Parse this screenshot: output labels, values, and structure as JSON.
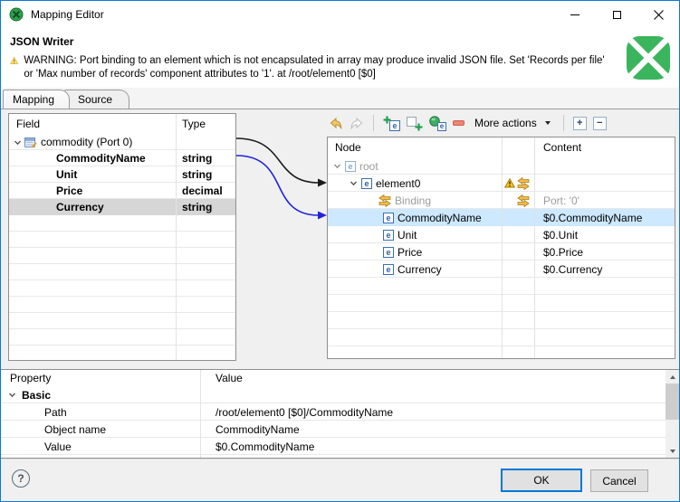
{
  "colors": {
    "window_border": "#0a7ad4",
    "clover_green": "#3bb55d",
    "selection_blue": "#cde8ff",
    "selection_gray": "#d6d6d6",
    "warning_yellow": "#f5bd42",
    "arrow_black": "#1a1a1a",
    "arrow_blue": "#2222dd"
  },
  "window": {
    "title": "Mapping Editor"
  },
  "header": {
    "title": "JSON Writer",
    "warning": "WARNING: Port binding to an element which is not encapsulated in array may produce invalid JSON file. Set 'Records per file' or 'Max number of records' component attributes to '1'. at /root/element0 [$0]"
  },
  "tabs": {
    "mapping": "Mapping",
    "source": "Source"
  },
  "icons": {
    "element_glyph": "e",
    "expand_glyph": "+",
    "collapse_glyph": "−",
    "help_glyph": "?"
  },
  "field_table": {
    "col_field": "Field",
    "col_type": "Type",
    "root": {
      "label": "commodity (Port 0)"
    },
    "rows": [
      {
        "field": "CommodityName",
        "type": "string",
        "selected": false
      },
      {
        "field": "Unit",
        "type": "string",
        "selected": false
      },
      {
        "field": "Price",
        "type": "decimal",
        "selected": false
      },
      {
        "field": "Currency",
        "type": "string",
        "selected": true
      }
    ]
  },
  "toolbar": {
    "more_actions": "More actions",
    "buttons": [
      "undo",
      "redo",
      "add-child-element",
      "add-property",
      "add-wildcard-element",
      "remove",
      "more-actions",
      "expand-all",
      "collapse-all"
    ]
  },
  "node_table": {
    "col_node": "Node",
    "col_content": "Content",
    "rows": [
      {
        "label": "root",
        "content": "",
        "muted": true,
        "selected": false
      },
      {
        "label": "element0",
        "content": "",
        "warning": true,
        "selected": false
      },
      {
        "label": "Binding",
        "content": "Port: '0'",
        "muted": true,
        "selected": false
      },
      {
        "label": "CommodityName",
        "content": "$0.CommodityName",
        "selected": true
      },
      {
        "label": "Unit",
        "content": "$0.Unit",
        "selected": false
      },
      {
        "label": "Price",
        "content": "$0.Price",
        "selected": false
      },
      {
        "label": "Currency",
        "content": "$0.Currency",
        "selected": false
      }
    ]
  },
  "property_table": {
    "col_property": "Property",
    "col_value": "Value",
    "group": "Basic",
    "rows": [
      {
        "property": "Path",
        "value": "/root/element0 [$0]/CommodityName"
      },
      {
        "property": "Object name",
        "value": "CommodityName"
      },
      {
        "property": "Value",
        "value": "$0.CommodityName"
      }
    ]
  },
  "footer": {
    "ok": "OK",
    "cancel": "Cancel"
  }
}
